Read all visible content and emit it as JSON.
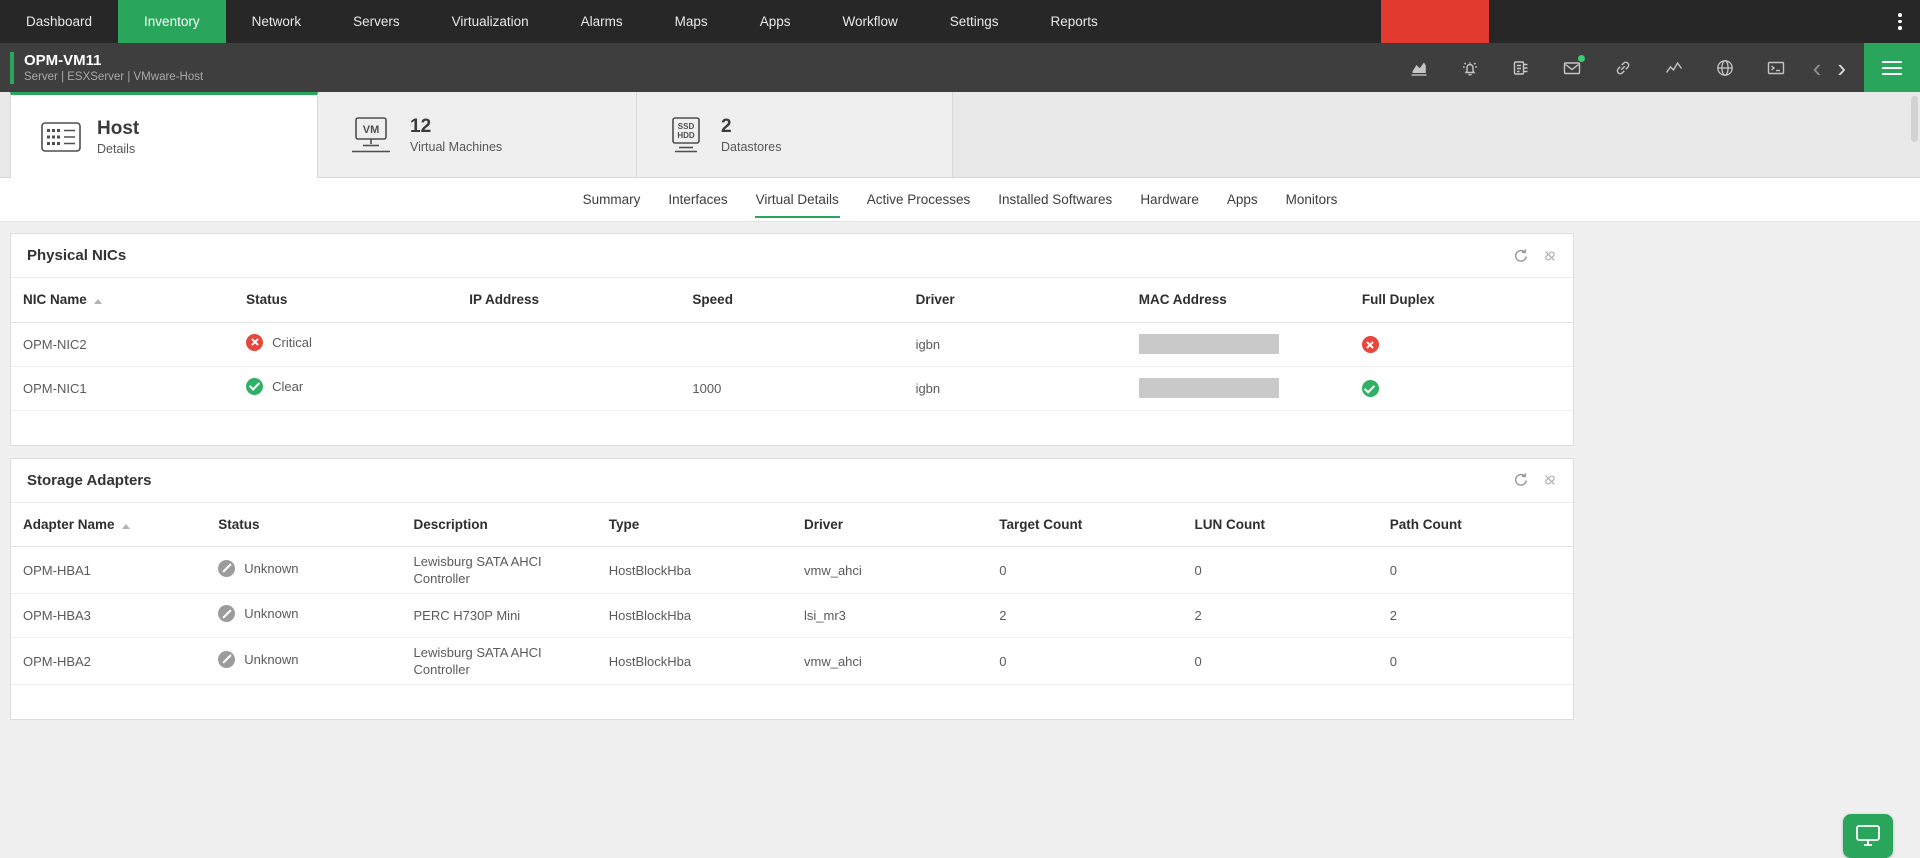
{
  "topnav": {
    "items": [
      {
        "label": "Dashboard",
        "active": false
      },
      {
        "label": "Inventory",
        "active": true
      },
      {
        "label": "Network",
        "active": false
      },
      {
        "label": "Servers",
        "active": false
      },
      {
        "label": "Virtualization",
        "active": false
      },
      {
        "label": "Alarms",
        "active": false
      },
      {
        "label": "Maps",
        "active": false
      },
      {
        "label": "Apps",
        "active": false
      },
      {
        "label": "Workflow",
        "active": false
      },
      {
        "label": "Settings",
        "active": false
      },
      {
        "label": "Reports",
        "active": false
      }
    ]
  },
  "device_header": {
    "title": "OPM-VM11",
    "subtitle": "Server | ESXServer | VMware-Host",
    "action_icons": [
      "performance-chart-icon",
      "alarm-bell-icon",
      "device-template-icon",
      "mail-icon",
      "link-icon",
      "trend-line-icon",
      "globe-icon",
      "console-icon"
    ],
    "pager": {
      "prev": "chevron-left-icon",
      "next": "chevron-right-icon"
    },
    "menu": "hamburger-menu-icon"
  },
  "device_tabs": [
    {
      "title": "Host",
      "subtitle": "Details",
      "icon": "host-server-icon",
      "active": true
    },
    {
      "count": "12",
      "label": "Virtual Machines",
      "icon": "vm-monitor-icon",
      "icon_label": "VM",
      "active": false
    },
    {
      "count": "2",
      "label": "Datastores",
      "icon": "datastore-icon",
      "icon_label_top": "SSD",
      "icon_label_bottom": "HDD",
      "active": false
    }
  ],
  "subtabs": {
    "items": [
      "Summary",
      "Interfaces",
      "Virtual Details",
      "Active Processes",
      "Installed Softwares",
      "Hardware",
      "Apps",
      "Monitors"
    ],
    "active": "Virtual Details"
  },
  "physical_nics": {
    "title": "Physical NICs",
    "sort_column": "NIC Name",
    "actions": [
      "refresh-icon",
      "detach-panel-icon"
    ],
    "columns": [
      "NIC Name",
      "Status",
      "IP Address",
      "Speed",
      "Driver",
      "MAC Address",
      "Full Duplex"
    ],
    "rows": [
      {
        "nic_name": "OPM-NIC2",
        "status": "Critical",
        "status_icon": "x-circle-icon",
        "ip_address": "",
        "speed": "",
        "driver": "igbn",
        "mac_masked": true,
        "full_duplex_icon": "x-circle-icon"
      },
      {
        "nic_name": "OPM-NIC1",
        "status": "Clear",
        "status_icon": "check-circle-icon",
        "ip_address": "",
        "speed": "1000",
        "driver": "igbn",
        "mac_masked": true,
        "full_duplex_icon": "check-circle-icon"
      }
    ]
  },
  "storage_adapters": {
    "title": "Storage Adapters",
    "sort_column": "Adapter Name",
    "actions": [
      "refresh-icon",
      "detach-panel-icon"
    ],
    "columns": [
      "Adapter Name",
      "Status",
      "Description",
      "Type",
      "Driver",
      "Target Count",
      "LUN Count",
      "Path Count"
    ],
    "rows": [
      {
        "adapter_name": "OPM-HBA1",
        "status": "Unknown",
        "status_icon": "slash-circle-icon",
        "description": "Lewisburg SATA AHCI Controller",
        "type": "HostBlockHba",
        "driver": "vmw_ahci",
        "target_count": "0",
        "lun_count": "0",
        "path_count": "0"
      },
      {
        "adapter_name": "OPM-HBA3",
        "status": "Unknown",
        "status_icon": "slash-circle-icon",
        "description": "PERC H730P Mini",
        "type": "HostBlockHba",
        "driver": "lsi_mr3",
        "target_count": "2",
        "lun_count": "2",
        "path_count": "2"
      },
      {
        "adapter_name": "OPM-HBA2",
        "status": "Unknown",
        "status_icon": "slash-circle-icon",
        "description": "Lewisburg SATA AHCI Controller",
        "type": "HostBlockHba",
        "driver": "vmw_ahci",
        "target_count": "0",
        "lun_count": "0",
        "path_count": "0"
      }
    ]
  },
  "colors": {
    "brand_green": "#2aa55c",
    "critical_red": "#e8463c",
    "clear_green": "#2eb166",
    "unknown_gray": "#9c9c9c",
    "nav_alert_red": "#e23a2e",
    "nav_bg": "#272727",
    "header_bg": "#3e3e3e"
  }
}
